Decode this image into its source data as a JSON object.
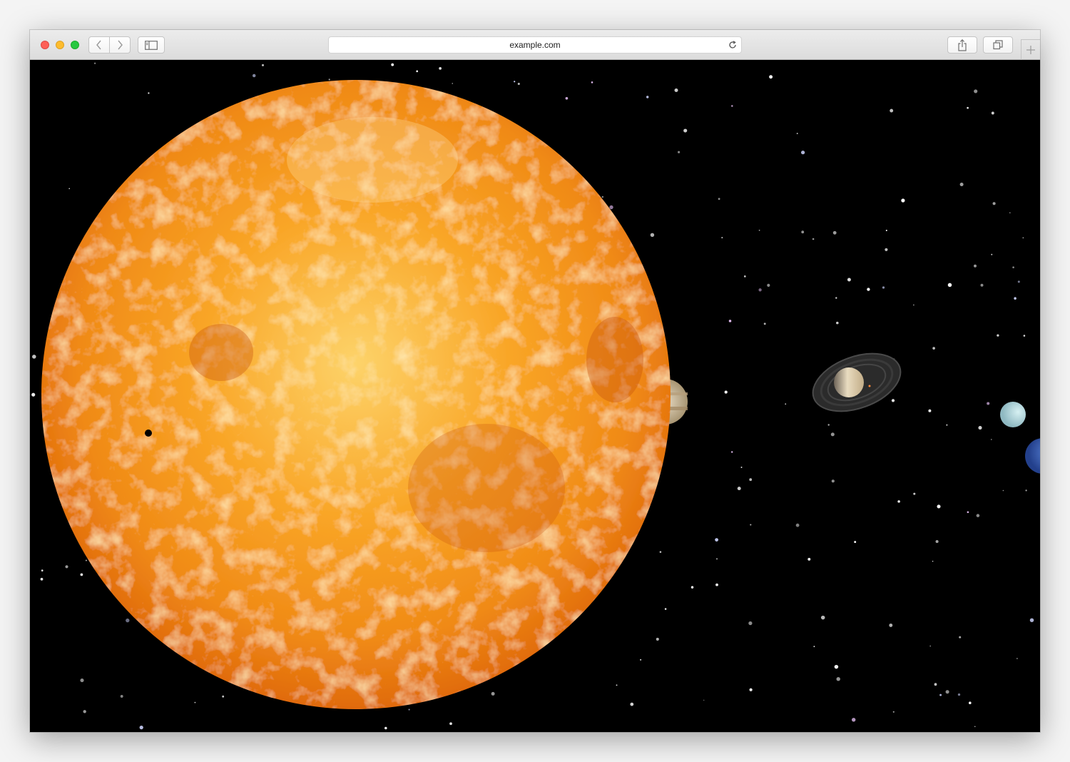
{
  "browser": {
    "url": "example.com",
    "icons": {
      "close": "close-light",
      "minimize": "minimize-light",
      "zoom": "zoom-light",
      "back": "chevron-left-icon",
      "forward": "chevron-right-icon",
      "sidebar": "sidebar-icon",
      "reload": "reload-icon",
      "share": "share-icon",
      "tabs": "tabs-overview-icon",
      "new_tab": "plus-icon"
    }
  },
  "scene": {
    "background": "#000000",
    "sun_color": "#f08a16",
    "bodies": [
      "sun",
      "jupiter",
      "saturn",
      "uranus",
      "neptune"
    ]
  }
}
